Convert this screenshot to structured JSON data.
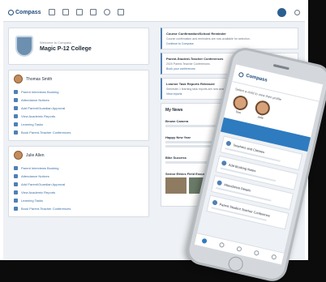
{
  "app": {
    "name": "Compass"
  },
  "school": {
    "header_small": "Welcome to Compass",
    "name": "Magic P-12 College"
  },
  "classes": [
    {
      "title": "Thomas Smith",
      "links": [
        "Parent Interviews Booking",
        "Attendance Notices",
        "Add Parent/Guardian Approval",
        "View Academic Reports",
        "Learning Tasks",
        "Book Parent-Teacher Conferences"
      ]
    },
    {
      "title": "Julie Allen",
      "links": [
        "Parent Interviews Booking",
        "Attendance Notices",
        "Add Parent/Guardian Approval",
        "View Academic Reports",
        "Learning Tasks",
        "Book Parent-Teacher Conferences"
      ]
    }
  ],
  "notices": [
    {
      "title": "Course Confirmation/School Reminder",
      "body": "Course confirmation and reminders are now available for selection.",
      "link": "Continue to Compass"
    },
    {
      "title": "Parent-Student-Teacher Conferences",
      "body": "2020 Parent-Teacher Conferences.",
      "link": "Book your conferences"
    },
    {
      "title": "Learner Task Reports Released",
      "body": "Semester 1 learning task reports are now available for viewing.",
      "link": "View reports"
    }
  ],
  "feed": {
    "title": "My News",
    "items": [
      {
        "heading": "Brown Camera"
      },
      {
        "heading": "Happy New Year"
      },
      {
        "heading": "Bike Success"
      },
      {
        "heading": "Senior Ethics Field Excursion visit"
      }
    ]
  },
  "phone": {
    "title": "Compass",
    "prompt": "Select a child to view their profile",
    "kids": [
      "Tom",
      "Julie"
    ],
    "cards": [
      "Teachers and Classes",
      "Add Booking Notes",
      "Attendance Details",
      "Parent Student Teacher Conference"
    ]
  },
  "colors": {
    "brand": "#1f4b7a",
    "accent": "#2e7bc0",
    "link": "#3b6da3"
  }
}
